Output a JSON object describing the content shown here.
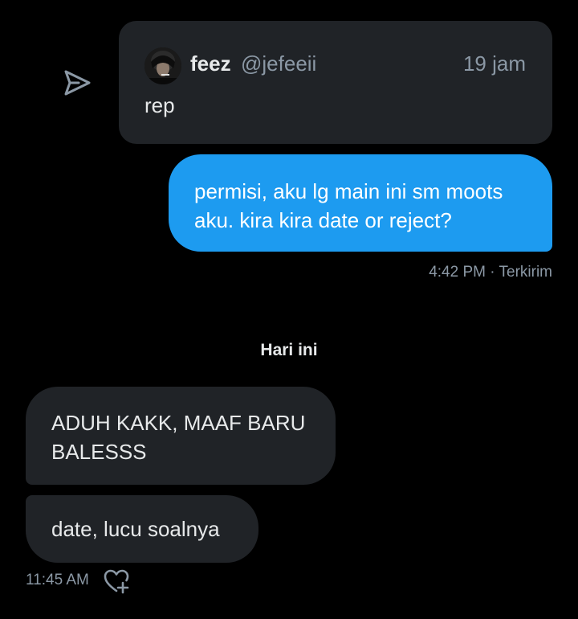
{
  "quoted_message": {
    "name": "feez",
    "handle": "@jefeeii",
    "time": "19 jam",
    "text": "rep"
  },
  "sent_message": {
    "text": "permisi, aku lg main ini sm moots aku. kira kira date or reject?",
    "meta": "4:42 PM · Terkirim"
  },
  "day_divider": "Hari ini",
  "received_messages": [
    {
      "text": "ADUH KAKK, MAAF BARU BALESSS"
    },
    {
      "text": "date, lucu soalnya"
    }
  ],
  "received_meta": "11:45 AM",
  "icons": {
    "share": "share-icon",
    "reaction": "heart-plus-icon"
  },
  "colors": {
    "background": "#000000",
    "bubble_sent": "#1d9bf0",
    "bubble_received": "#202327",
    "secondary_text": "#8b98a5"
  }
}
